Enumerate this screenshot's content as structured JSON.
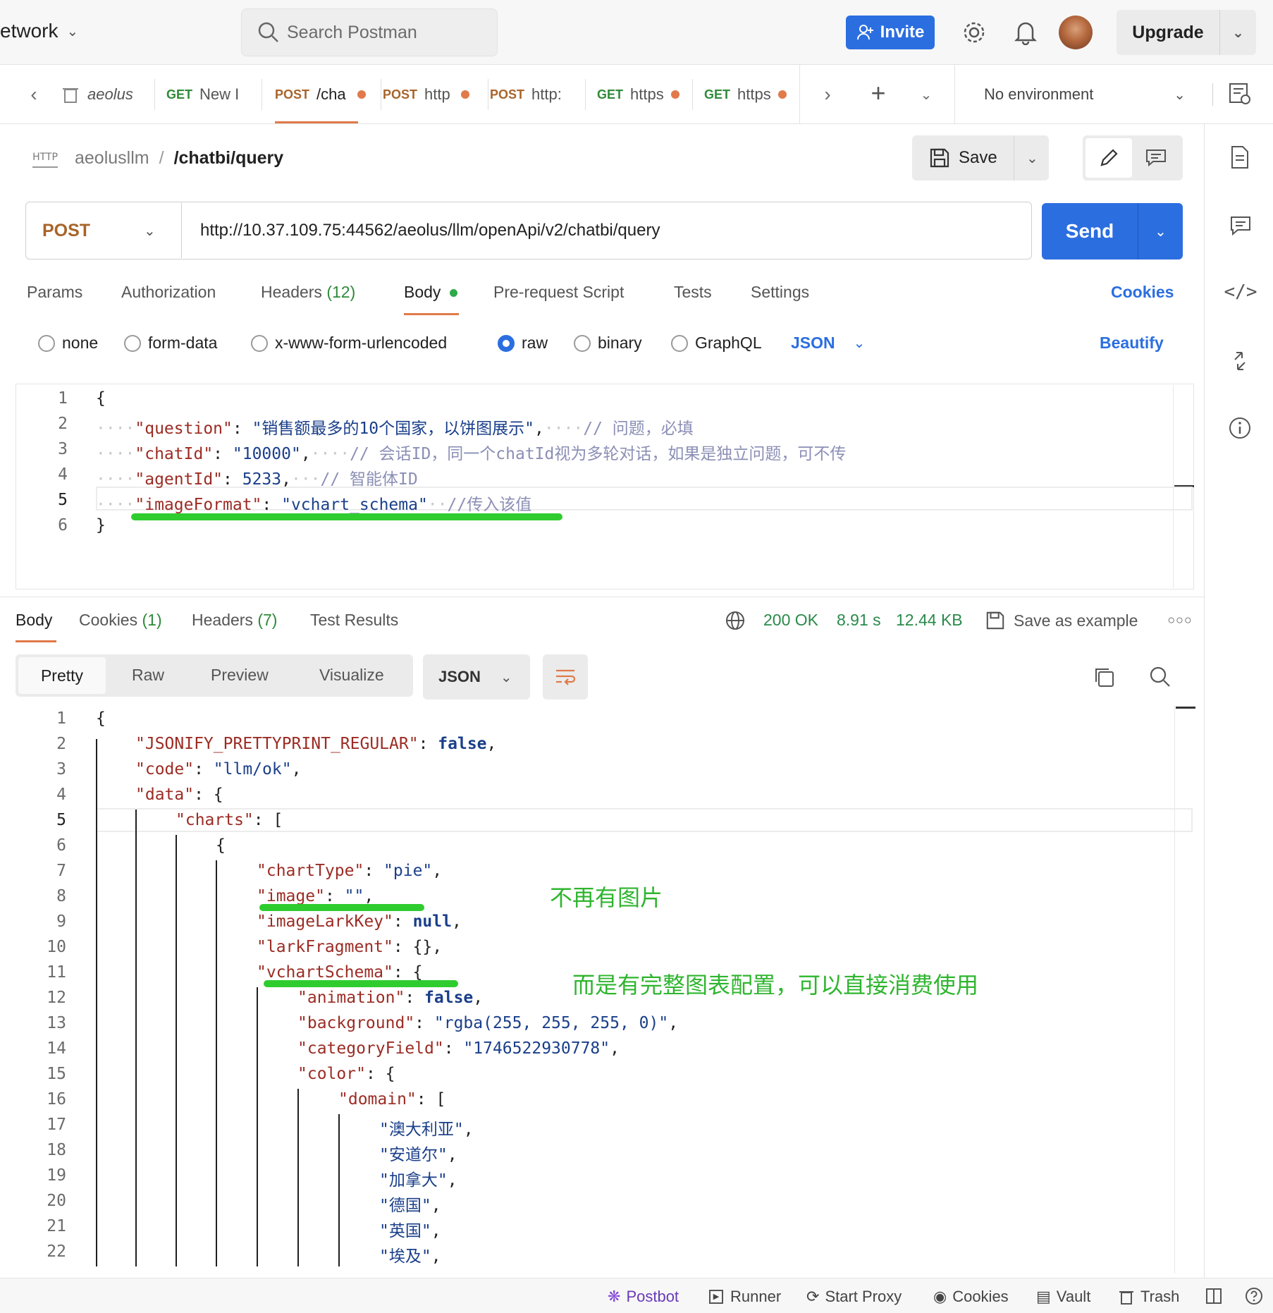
{
  "header": {
    "workspace": "etwork",
    "search_placeholder": "Search Postman",
    "invite_label": "Invite",
    "upgrade_label": "Upgrade"
  },
  "tabs": [
    {
      "method": "",
      "name": "aeolus",
      "dot": false
    },
    {
      "method": "GET",
      "name": "New I",
      "dot": false
    },
    {
      "method": "POST",
      "name": "/cha",
      "dot": true,
      "active": true
    },
    {
      "method": "POST",
      "name": "http",
      "dot": true
    },
    {
      "method": "POST",
      "name": "http:",
      "dot": false
    },
    {
      "method": "GET",
      "name": "https",
      "dot": true
    },
    {
      "method": "GET",
      "name": "https",
      "dot": true
    }
  ],
  "environment": "No environment",
  "request": {
    "icon_label": "HTTP",
    "collection": "aeolusllm",
    "separator": "/",
    "name": "/chatbi/query",
    "save_label": "Save",
    "method": "POST",
    "url": "http://10.37.109.75:44562/aeolus/llm/openApi/v2/chatbi/query",
    "send_label": "Send"
  },
  "req_tabs": {
    "params": "Params",
    "authorization": "Authorization",
    "headers": "Headers",
    "headers_count": "(12)",
    "body": "Body",
    "prerequest": "Pre-request Script",
    "tests": "Tests",
    "settings": "Settings",
    "cookies": "Cookies"
  },
  "body_types": {
    "none": "none",
    "form_data": "form-data",
    "urlencoded": "x-www-form-urlencoded",
    "raw": "raw",
    "binary": "binary",
    "graphql": "GraphQL",
    "format": "JSON",
    "beautify": "Beautify"
  },
  "req_body": {
    "l1": "{",
    "l2k": "\"question\"",
    "l2v": "\"销售额最多的10个国家，以饼图展示\"",
    "l2c": "// 问题，必填",
    "l3k": "\"chatId\"",
    "l3v": "\"10000\"",
    "l3c": "// 会话ID，同一个chatId视为多轮对话，如果是独立问题，可不传",
    "l4k": "\"agentId\"",
    "l4v": "5233",
    "l4c": "// 智能体ID",
    "l5k": "\"imageFormat\"",
    "l5v": "\"vchart_schema\"",
    "l5c": "//传入该值",
    "l6": "}"
  },
  "resp_tabs": {
    "body": "Body",
    "cookies": "Cookies",
    "cookies_count": "(1)",
    "headers": "Headers",
    "headers_count": "(7)",
    "test_results": "Test Results",
    "status": "200 OK",
    "time": "8.91 s",
    "size": "12.44 KB",
    "save_example": "Save as example"
  },
  "view_tabs": {
    "pretty": "Pretty",
    "raw": "Raw",
    "preview": "Preview",
    "visualize": "Visualize",
    "format": "JSON"
  },
  "resp_body": {
    "l1": "{",
    "l2k": "\"JSONIFY_PRETTYPRINT_REGULAR\"",
    "l2v": "false",
    "l3k": "\"code\"",
    "l3v": "\"llm/ok\"",
    "l4k": "\"data\"",
    "l4p": "{",
    "l5k": "\"charts\"",
    "l5p": "[",
    "l6": "{",
    "l7k": "\"chartType\"",
    "l7v": "\"pie\"",
    "l8k": "\"image\"",
    "l8v": "\"\"",
    "l9k": "\"imageLarkKey\"",
    "l9v": "null",
    "l10k": "\"larkFragment\"",
    "l10v": "{}",
    "l11k": "\"vchartSchema\"",
    "l11p": "{",
    "l12k": "\"animation\"",
    "l12v": "false",
    "l13k": "\"background\"",
    "l13v": "\"rgba(255, 255, 255, 0)\"",
    "l14k": "\"categoryField\"",
    "l14v": "\"1746522930778\"",
    "l15k": "\"color\"",
    "l15p": "{",
    "l16k": "\"domain\"",
    "l16p": "[",
    "l17": "\"澳大利亚\"",
    "l18": "\"安道尔\"",
    "l19": "\"加拿大\"",
    "l20": "\"德国\"",
    "l21": "\"英国\"",
    "l22": "\"埃及\""
  },
  "annotations": {
    "no_image": "不再有图片",
    "full_config": "而是有完整图表配置，可以直接消费使用"
  },
  "footer": {
    "postbot": "Postbot",
    "runner": "Runner",
    "proxy": "Start Proxy",
    "cookies": "Cookies",
    "vault": "Vault",
    "trash": "Trash"
  },
  "colors": {
    "accent": "#2b6ee0",
    "post": "#a8642a",
    "get": "#2f8a3a",
    "annotation": "#2fcc2f",
    "status_ok": "#2a8a4a"
  }
}
